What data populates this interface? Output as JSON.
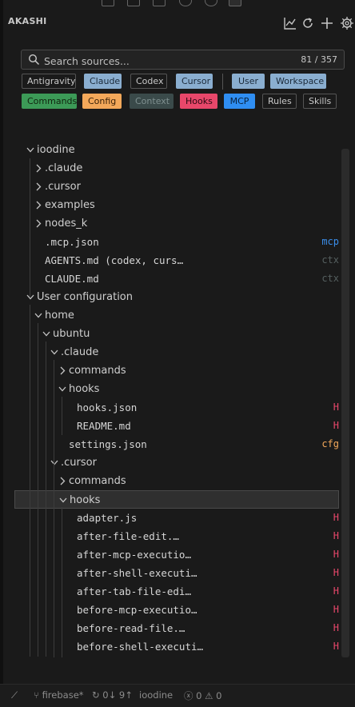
{
  "header": {
    "title": "AKASHI"
  },
  "search": {
    "placeholder": "Search sources...",
    "count": "81 / 357"
  },
  "chips_row1": [
    {
      "label": "Antigravity",
      "active": false
    },
    {
      "label": "Claude",
      "active": true,
      "bg": "#8aaed0",
      "fg": "#1b2a3a"
    },
    {
      "label": "Codex",
      "active": false
    },
    {
      "label": "Cursor",
      "active": true,
      "bg": "#8aaed0",
      "fg": "#1b2a3a"
    },
    {
      "label": "User",
      "active": true,
      "bg": "#8aaed0",
      "fg": "#1b2a3a"
    },
    {
      "label": "Workspace",
      "active": true,
      "bg": "#8aaed0",
      "fg": "#1b2a3a"
    }
  ],
  "chips_row2": [
    {
      "label": "Commands",
      "active": true,
      "bg": "#3c9a57",
      "fg": "#10240f"
    },
    {
      "label": "Config",
      "active": true,
      "bg": "#f3a85a",
      "fg": "#3a2108"
    },
    {
      "label": "Context",
      "active": true,
      "bg": "#3a4a4a",
      "fg": "#7f9090"
    },
    {
      "label": "Hooks",
      "active": true,
      "bg": "#e8476a",
      "fg": "#2a0810"
    },
    {
      "label": "MCP",
      "active": true,
      "bg": "#2f8ef2",
      "fg": "#08213c"
    },
    {
      "label": "Rules",
      "active": false
    },
    {
      "label": "Skills",
      "active": false
    }
  ],
  "colors": {
    "hooks": "#e8476a",
    "mcp": "#3b8eea",
    "config": "#f3a85a",
    "ctx": "#555f5f"
  },
  "tree": [
    {
      "label": "ioodine",
      "level": 0,
      "chev": "down"
    },
    {
      "label": ".claude",
      "level": 1,
      "chev": "right"
    },
    {
      "label": ".cursor",
      "level": 1,
      "chev": "right"
    },
    {
      "label": "examples",
      "level": 1,
      "chev": "right"
    },
    {
      "label": "nodes_k",
      "level": 1,
      "chev": "right"
    },
    {
      "label": ".mcp.json",
      "level": 1,
      "file": true,
      "badge": "mcp",
      "badge_kind": "mcp"
    },
    {
      "label": "AGENTS.md (codex, curs…",
      "level": 1,
      "file": true,
      "badge": "ctx",
      "badge_kind": "ctx"
    },
    {
      "label": "CLAUDE.md",
      "level": 1,
      "file": true,
      "badge": "ctx",
      "badge_kind": "ctx"
    },
    {
      "label": "User configuration",
      "level": 0,
      "chev": "down"
    },
    {
      "label": "home",
      "level": 1,
      "chev": "down"
    },
    {
      "label": "ubuntu",
      "level": 2,
      "chev": "down"
    },
    {
      "label": ".claude",
      "level": 3,
      "chev": "down"
    },
    {
      "label": "commands",
      "level": 4,
      "chev": "right"
    },
    {
      "label": "hooks",
      "level": 4,
      "chev": "down"
    },
    {
      "label": "hooks.json",
      "level": 5,
      "file": true,
      "badge": "H",
      "badge_kind": "hooks"
    },
    {
      "label": "README.md",
      "level": 5,
      "file": true,
      "badge": "H",
      "badge_kind": "hooks"
    },
    {
      "label": "settings.json",
      "level": 4,
      "file": true,
      "badge": "cfg",
      "badge_kind": "config"
    },
    {
      "label": ".cursor",
      "level": 3,
      "chev": "down"
    },
    {
      "label": "commands",
      "level": 4,
      "chev": "right"
    },
    {
      "label": "hooks",
      "level": 4,
      "chev": "down",
      "selected": true
    },
    {
      "label": "adapter.js",
      "level": 5,
      "file": true,
      "badge": "H",
      "badge_kind": "hooks"
    },
    {
      "label": "after-file-edit.…",
      "level": 5,
      "file": true,
      "badge": "H",
      "badge_kind": "hooks"
    },
    {
      "label": "after-mcp-executio…",
      "level": 5,
      "file": true,
      "badge": "H",
      "badge_kind": "hooks"
    },
    {
      "label": "after-shell-executi…",
      "level": 5,
      "file": true,
      "badge": "H",
      "badge_kind": "hooks"
    },
    {
      "label": "after-tab-file-edi…",
      "level": 5,
      "file": true,
      "badge": "H",
      "badge_kind": "hooks"
    },
    {
      "label": "before-mcp-executio…",
      "level": 5,
      "file": true,
      "badge": "H",
      "badge_kind": "hooks"
    },
    {
      "label": "before-read-file.…",
      "level": 5,
      "file": true,
      "badge": "H",
      "badge_kind": "hooks"
    },
    {
      "label": "before-shell-executi…",
      "level": 5,
      "file": true,
      "badge": "H",
      "badge_kind": "hooks"
    }
  ],
  "status": {
    "branch": "firebase*",
    "sync": "0↓ 9↑",
    "workspace": "ioodine",
    "errors": "0",
    "warnings": "0"
  }
}
